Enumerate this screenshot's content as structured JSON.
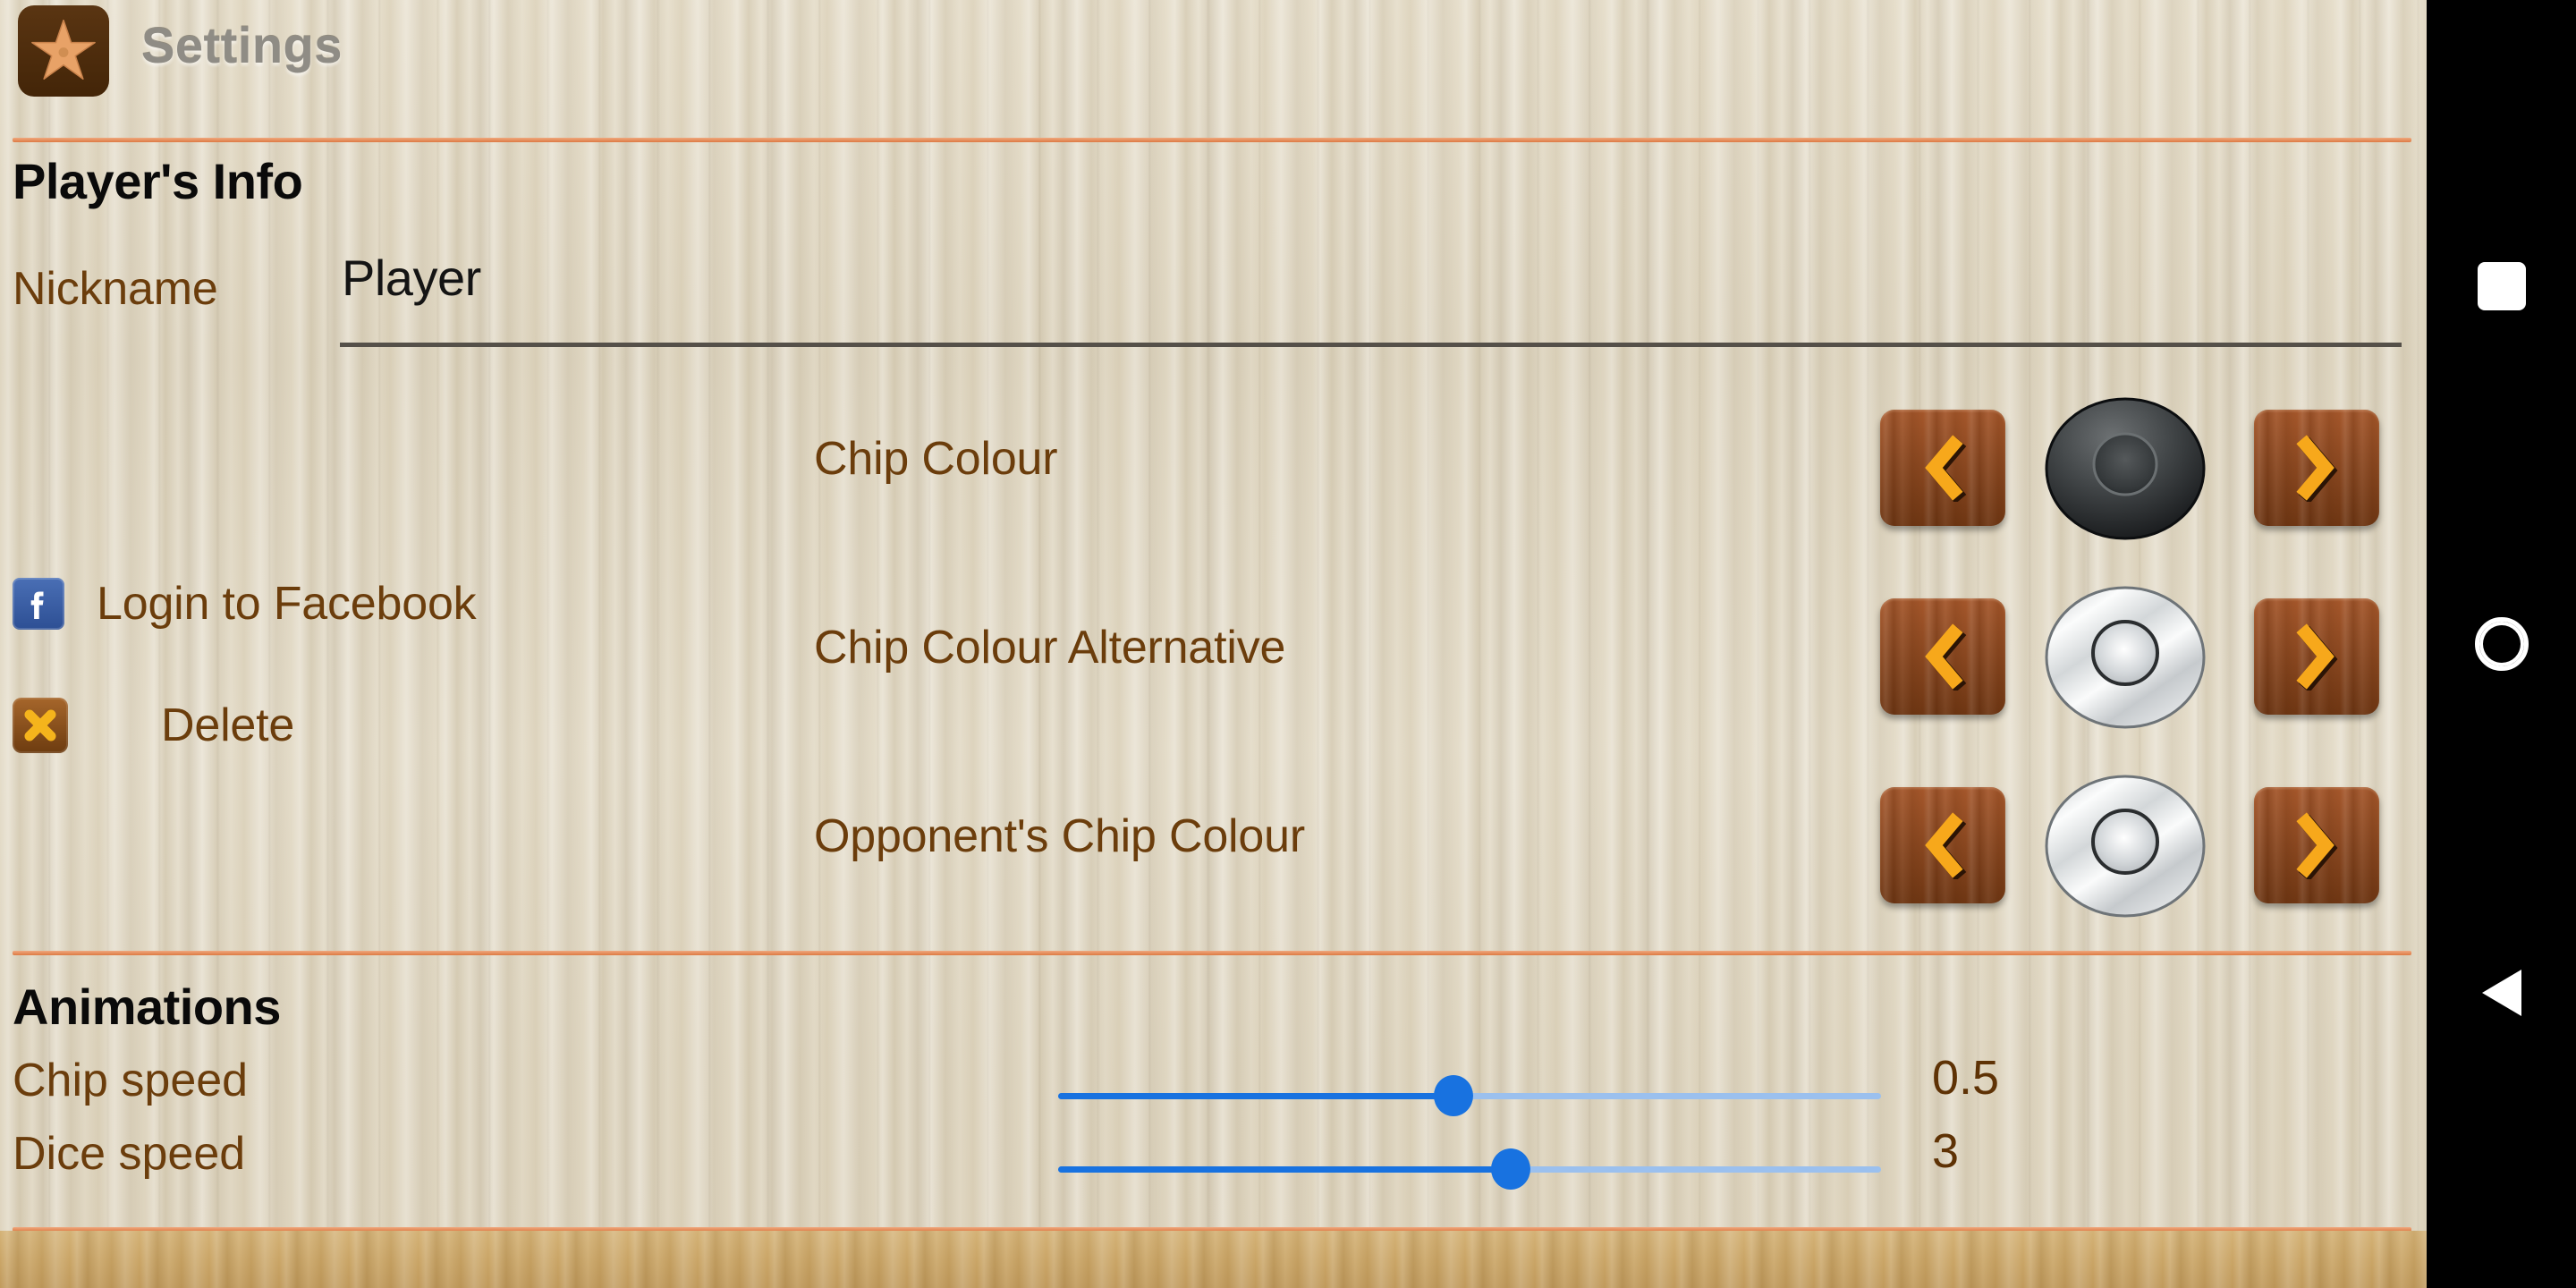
{
  "header": {
    "title": "Settings",
    "app_icon": "starfish-icon"
  },
  "colors": {
    "divider": "#dd7a43",
    "brown_text": "#6b3d0c",
    "heading_text": "#0a0a0a",
    "slider_active": "#1872e0",
    "slider_inactive": "#9bc0ee",
    "button_wood": "#8e4a22",
    "arrow_glyph": "#f7a81b",
    "facebook_blue": "#2d4f94",
    "delete_orange": "#a6662b",
    "panel_background": "#ded5c0",
    "navbar_background": "#000000"
  },
  "sections": {
    "player_info": {
      "title": "Player's Info",
      "nickname_label": "Nickname",
      "nickname_value": "Player",
      "nickname_placeholder": "Nickname",
      "facebook": {
        "label": "Login to Facebook",
        "icon": "facebook-icon"
      },
      "delete": {
        "label": "Delete",
        "icon": "delete-x-icon"
      }
    },
    "chip_colours": {
      "rows": [
        {
          "label": "Chip Colour",
          "swatch": "chip-black",
          "prev": "chevron-left-icon",
          "next": "chevron-right-icon"
        },
        {
          "label": "Chip Colour Alternative",
          "swatch": "chip-silver",
          "prev": "chevron-left-icon",
          "next": "chevron-right-icon"
        },
        {
          "label": "Opponent's Chip Colour",
          "swatch": "chip-silver",
          "prev": "chevron-left-icon",
          "next": "chevron-right-icon"
        }
      ]
    },
    "animations": {
      "title": "Animations",
      "sliders": [
        {
          "label": "Chip speed",
          "value": "0.5",
          "fill_percent": 48
        },
        {
          "label": "Dice speed",
          "value": "3",
          "fill_percent": 55
        }
      ]
    }
  },
  "navbar": {
    "recents": "recents-square-icon",
    "home": "home-circle-icon",
    "back": "back-triangle-icon"
  }
}
